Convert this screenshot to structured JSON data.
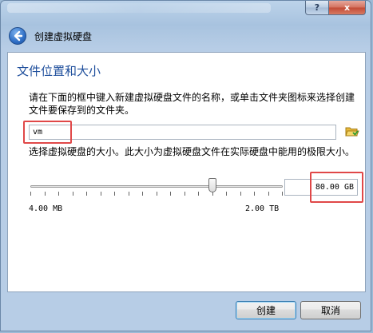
{
  "window": {
    "help_label": "?",
    "close_label": "x"
  },
  "header": {
    "title": "创建虚拟硬盘"
  },
  "page": {
    "title": "文件位置和大小",
    "location_description": "请在下面的框中键入新建虚拟硬盘文件的名称，或单击文件夹图标来选择创建文件要保存到的文件夹。",
    "file_name_value": "vm",
    "size_description": "选择虚拟硬盘的大小。此大小为虚拟硬盘文件在实际硬盘中能用的极限大小。",
    "size_min_label": "4.00 MB",
    "size_max_label": "2.00 TB",
    "size_value": "80.00 GB",
    "slider_fraction": 0.72
  },
  "buttons": {
    "create_label": "创建",
    "cancel_label": "取消"
  },
  "icons": {
    "back": "back-arrow-icon",
    "folder": "folder-open-icon"
  },
  "colors": {
    "title_blue": "#1f4f9c",
    "highlight_red": "#e04848"
  }
}
